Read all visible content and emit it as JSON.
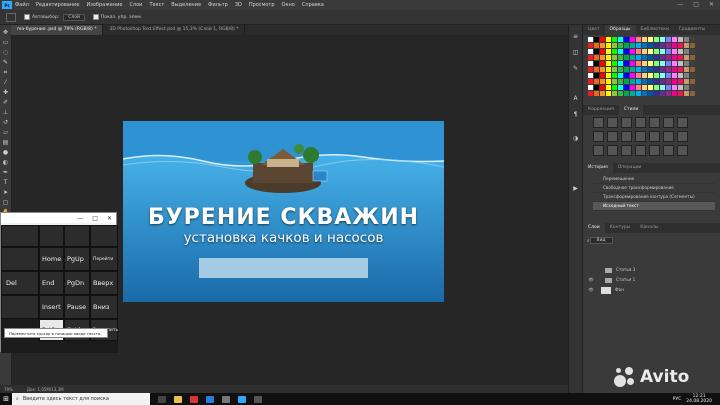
{
  "menubar": {
    "logo": "Ps",
    "items": [
      "Файл",
      "Редактирование",
      "Изображение",
      "Слои",
      "Текст",
      "Выделение",
      "Фильтр",
      "3D",
      "Просмотр",
      "Окно",
      "Справка"
    ]
  },
  "options": {
    "autoselect_label": "Автовыбор:",
    "autoselect_value": "Слой",
    "show_controls_label": "Показ. упр. элем."
  },
  "doc_tabs": [
    {
      "label": "ma-бурение .psd @ 79% (RGB/8) *",
      "active": true
    },
    {
      "label": "3D Photoshop Text Effect.psd @ 15,3% (Слой 1, RGB/8) *",
      "active": false
    }
  ],
  "banner": {
    "title": "БУРЕНИЕ СКВАЖИН",
    "subtitle": "установка качков и насосов"
  },
  "statusbar": {
    "zoom": "79%",
    "doc_info": "Док: 1,05М/13,3М"
  },
  "panels": {
    "top_tabs": [
      "Цвет",
      "Образцы",
      "Библиотеки",
      "Градиенты"
    ],
    "mid_tabs": [
      "Коррекция",
      "Стили"
    ],
    "history_tabs": [
      "История",
      "Операции"
    ],
    "history_items": [
      "Перемещение",
      "Свободное трансформирование",
      "Трансформирование контура (Сегменты)",
      "Исходный текст"
    ],
    "layers_tabs": [
      "Слои",
      "Контуры",
      "Каналы"
    ],
    "layers_kind": "Вид",
    "layers": [
      {
        "name": "Статья 3",
        "type": "folder"
      },
      {
        "name": "Статья 1",
        "type": "folder"
      },
      {
        "name": "Фон",
        "type": "layer"
      }
    ]
  },
  "osk": {
    "title_buttons": [
      "—",
      "□",
      "✕"
    ],
    "rows": [
      [
        "Home",
        "PgUp",
        "Перейти"
      ],
      [
        "Del",
        "End",
        "PgDn",
        "Вверх"
      ],
      [
        "Insert",
        "Pause",
        "Вниз"
      ],
      [
        "PrtScn",
        "ScLk",
        "Закрепить"
      ]
    ],
    "tooltip": "Переместите курсор в позицию ввода текста."
  },
  "taskbar": {
    "search_placeholder": "Введите здесь текст для поиска",
    "lang": "РУС",
    "time": "12:21",
    "date": "24.08.2020"
  },
  "watermark": "Avito",
  "swatch_colors": [
    "#ffffff",
    "#000000",
    "#ff0000",
    "#ffff00",
    "#00ff00",
    "#00ffff",
    "#0000ff",
    "#ff00ff",
    "#ff8080",
    "#ffd080",
    "#ffff80",
    "#80ff80",
    "#80ffff",
    "#8080ff",
    "#ff80ff",
    "#c0c0c0",
    "#808080",
    "#404040",
    "#ed1c24",
    "#f26522",
    "#f7941d",
    "#fff200",
    "#8dc63f",
    "#39b54a",
    "#00a651",
    "#00a99d",
    "#00aeef",
    "#0072bc",
    "#0054a6",
    "#2e3192",
    "#662d91",
    "#92278f",
    "#ec008c",
    "#ed145b",
    "#c69c6d",
    "#8c6239"
  ]
}
